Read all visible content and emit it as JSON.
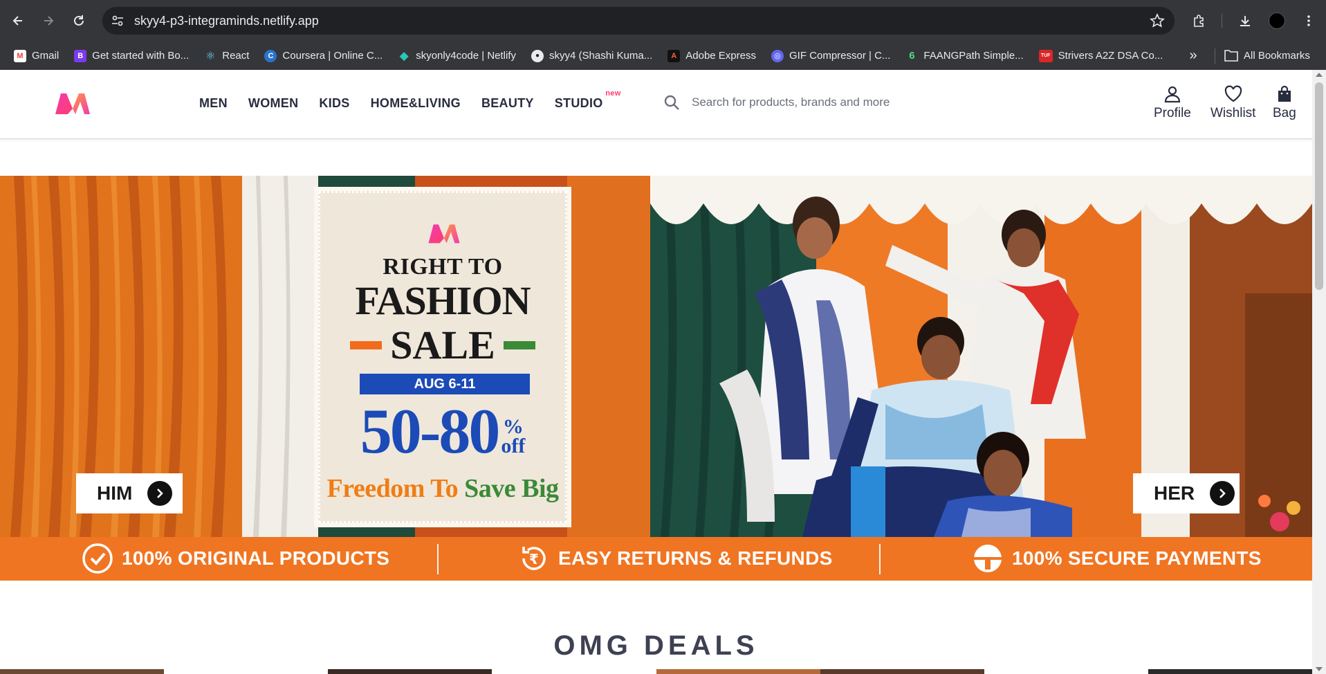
{
  "browser": {
    "url": "skyy4-p3-integraminds.netlify.app",
    "bookmarks": [
      {
        "label": "Gmail",
        "color": "#ea4335",
        "glyph": "M"
      },
      {
        "label": "Get started with Bo...",
        "color": "#7c3aed",
        "glyph": "B"
      },
      {
        "label": "React",
        "color": "#35363a",
        "glyph": "⚛"
      },
      {
        "label": "Coursera | Online C...",
        "color": "#2a73cc",
        "glyph": "C"
      },
      {
        "label": "skyonly4code | Netlify",
        "color": "#25c7b7",
        "glyph": "◆"
      },
      {
        "label": "skyy4 (Shashi Kuma...",
        "color": "#35363a",
        "glyph": "●"
      },
      {
        "label": "Adobe Express",
        "color": "#111111",
        "glyph": "A"
      },
      {
        "label": "GIF Compressor | C...",
        "color": "#6366f1",
        "glyph": "◎"
      },
      {
        "label": "FAANGPath Simple...",
        "color": "#35363a",
        "glyph": "6"
      },
      {
        "label": "Strivers A2Z DSA Co...",
        "color": "#dc2626",
        "glyph": "TUF"
      }
    ],
    "all_bookmarks": "All Bookmarks"
  },
  "header": {
    "nav": [
      "MEN",
      "WOMEN",
      "KIDS",
      "HOME&LIVING",
      "BEAUTY",
      "STUDIO"
    ],
    "studio_badge": "new",
    "search_placeholder": "Search for products, brands and more",
    "profile": "Profile",
    "wishlist": "Wishlist",
    "bag": "Bag"
  },
  "hero": {
    "line1": "RIGHT TO",
    "line2": "FASHION",
    "line3": "SALE",
    "dates": "AUG 6-11",
    "discount": "50-80",
    "pct": "%",
    "off": "off",
    "tagline_a": "Freedom To ",
    "tagline_b": "Save Big",
    "him": "HIM",
    "her": "HER"
  },
  "trust": {
    "original": "100% ORIGINAL PRODUCTS",
    "returns": "EASY RETURNS & REFUNDS",
    "secure": "100% SECURE PAYMENTS"
  },
  "deals_title": "OMG DEALS",
  "colors": {
    "brand_pink": "#ff3f6c",
    "trust_orange": "#f07522",
    "sale_blue": "#1c4bb7"
  }
}
